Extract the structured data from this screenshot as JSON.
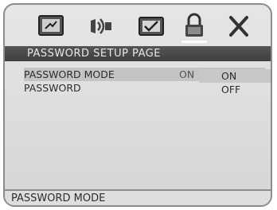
{
  "tabs": [
    {
      "icon": "general-setup-icon"
    },
    {
      "icon": "audio-setup-icon"
    },
    {
      "icon": "preference-icon"
    },
    {
      "icon": "lock-icon",
      "active": true
    },
    {
      "icon": "exit-icon"
    }
  ],
  "page_title": "PASSWORD SETUP PAGE",
  "menu": [
    {
      "label": "PASSWORD MODE",
      "value": "ON"
    },
    {
      "label": "PASSWORD",
      "value": ""
    }
  ],
  "options": [
    "ON",
    "OFF"
  ],
  "footer_text": "PASSWORD MODE",
  "colors": {
    "title_bar": "#4a4a4a",
    "panel": "#dcdcdc",
    "selected": "#c4c4c4"
  }
}
